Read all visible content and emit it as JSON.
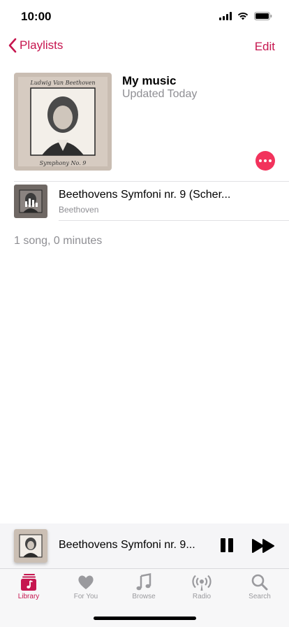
{
  "status": {
    "time": "10:00"
  },
  "nav": {
    "back_label": "Playlists",
    "edit_label": "Edit"
  },
  "playlist": {
    "title": "My music",
    "subtitle": "Updated Today",
    "cover_title": "Ludwig Van Beethoven",
    "cover_caption": "Symphony No. 9"
  },
  "songs": [
    {
      "title": "Beethovens Symfoni nr. 9 (Scher...",
      "artist": "Beethoven"
    }
  ],
  "summary": "1 song, 0 minutes",
  "now_playing": {
    "title": "Beethovens Symfoni nr. 9..."
  },
  "tabs": [
    {
      "label": "Library",
      "icon": "library-icon",
      "active": true
    },
    {
      "label": "For You",
      "icon": "heart-icon",
      "active": false
    },
    {
      "label": "Browse",
      "icon": "music-note-icon",
      "active": false
    },
    {
      "label": "Radio",
      "icon": "radio-icon",
      "active": false
    },
    {
      "label": "Search",
      "icon": "search-icon",
      "active": false
    }
  ],
  "colors": {
    "accent": "#c6164f",
    "more_button": "#f2335c",
    "inactive_tab": "#9a9a9e"
  }
}
